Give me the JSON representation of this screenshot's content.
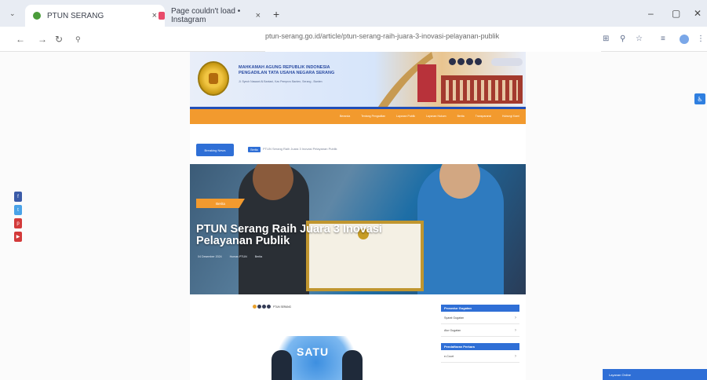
{
  "browser": {
    "tabs": [
      {
        "label": "PTUN SERANG",
        "active": true,
        "favicon_color": "#4a9c3a"
      },
      {
        "label": "Page couldn't load • Instagram",
        "active": false,
        "favicon_color": "#e84a6a"
      }
    ],
    "new_tab": "+",
    "window_controls": {
      "minimize": "–",
      "maximize": "▢",
      "close": "✕"
    },
    "url": "ptun-serang.go.id/article/ptun-serang-raih-juara-3-inovasi-pelayanan-publik"
  },
  "header": {
    "title_line1": "MAHKAMAH AGUNG REPUBLIK INDONESIA",
    "title_line2": "PENGADILAN TATA USAHA NEGARA SERANG",
    "subtitle": "Jl. Syech Nawawi Al Bantani, Kav Pemprov Banten, Serang - Banten"
  },
  "nav": {
    "items": [
      "Beranda",
      "Tentang Pengadilan",
      "Layanan Publik",
      "Layanan Hukum",
      "Berita",
      "Transparansi",
      "Hubungi Kami"
    ]
  },
  "breaking": {
    "label": "Breaking News",
    "tag": "Berita",
    "ticker": "PTUN Serang Raih Juara 3 Inovasi Pelayanan Publik"
  },
  "hero": {
    "category": "Berita",
    "headline": "PTUN Serang Raih Juara 3 Inovasi Pelayanan Publik",
    "meta_date": "04 Desember 2024",
    "meta_author": "Humas PTUN",
    "meta_views": "Berita"
  },
  "small_logo": {
    "label": "PTUN SERANG"
  },
  "promo": {
    "text": "SATU"
  },
  "sidebar": {
    "sections": [
      {
        "title": "Prosedur Gugatan",
        "items": [
          "Syarat Gugatan",
          "Alur Gugatan"
        ]
      },
      {
        "title": "Pendaftaran Perkara",
        "items": [
          "e-Court"
        ]
      }
    ]
  },
  "social": [
    {
      "icon": "facebook-icon",
      "glyph": "f",
      "color": "#3b5ba8"
    },
    {
      "icon": "twitter-icon",
      "glyph": "t",
      "color": "#4aa3e8"
    },
    {
      "icon": "pinterest-icon",
      "glyph": "p",
      "color": "#d33a3a"
    },
    {
      "icon": "youtube-icon",
      "glyph": "▶",
      "color": "#d33a3a"
    }
  ],
  "accessibility": {
    "glyph": "♿"
  },
  "corner_bar": {
    "label": "Layanan Online"
  }
}
